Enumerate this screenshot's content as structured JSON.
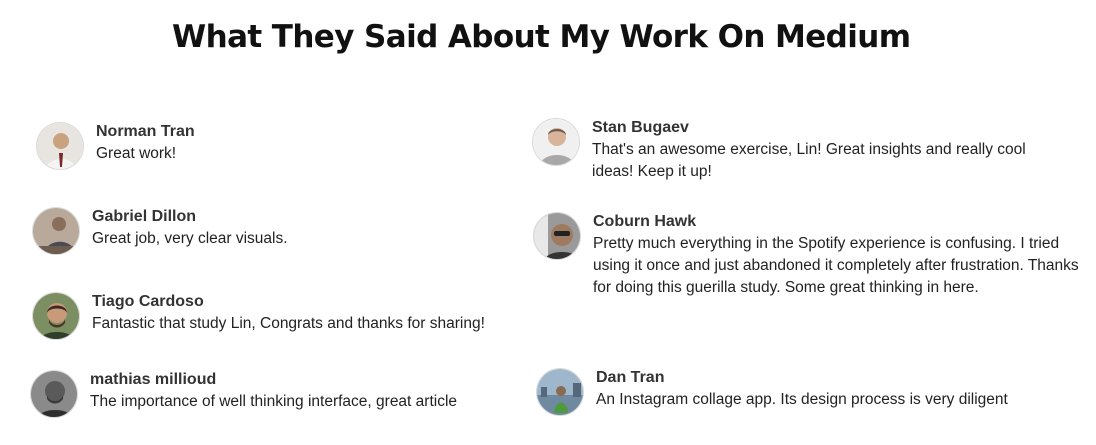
{
  "page": {
    "title": "What They Said About My Work On Medium"
  },
  "testimonials": [
    {
      "name": "Norman Tran",
      "quote": "Great work!",
      "avatar_icon": "person-avatar-icon",
      "avatar_color": "#c9a27e"
    },
    {
      "name": "Gabriel Dillon",
      "quote": "Great job, very clear visuals.",
      "avatar_icon": "person-avatar-icon",
      "avatar_color": "#7a6a60"
    },
    {
      "name": "Tiago Cardoso",
      "quote": "Fantastic that study Lin, Congrats and thanks for sharing!",
      "avatar_icon": "person-avatar-icon",
      "avatar_color": "#5f7a4f"
    },
    {
      "name": "mathias millioud",
      "quote": "The importance of well thinking interface, great article",
      "avatar_icon": "person-avatar-icon",
      "avatar_color": "#555555"
    },
    {
      "name": "Stan Bugaev",
      "quote": "That's an awesome exercise, Lin! Great insights and really cool ideas! Keep it up!",
      "avatar_icon": "person-avatar-icon",
      "avatar_color": "#cfcfcf"
    },
    {
      "name": "Coburn Hawk",
      "quote": "Pretty much everything in the Spotify experience is confusing. I tried using it once and just abandoned it completely after frustration. Thanks for doing this guerilla study. Some great thinking in here.",
      "avatar_icon": "person-avatar-icon",
      "avatar_color": "#6a6a6a"
    },
    {
      "name": "Dan Tran",
      "quote": "An Instagram collage app. Its design process is very diligent",
      "avatar_icon": "person-avatar-icon",
      "avatar_color": "#7d9bb5"
    }
  ]
}
